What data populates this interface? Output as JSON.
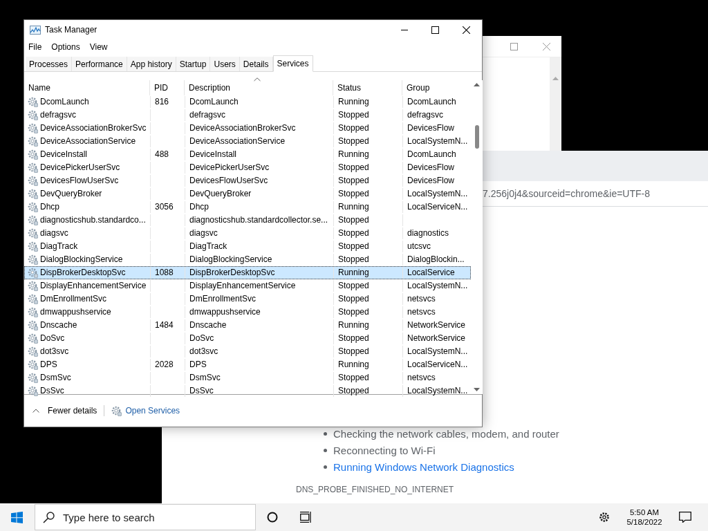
{
  "task_manager": {
    "title": "Task Manager",
    "menu": [
      "File",
      "Options",
      "View"
    ],
    "tabs": [
      {
        "label": "Processes",
        "selected": false
      },
      {
        "label": "Performance",
        "selected": false
      },
      {
        "label": "App history",
        "selected": false
      },
      {
        "label": "Startup",
        "selected": false
      },
      {
        "label": "Users",
        "selected": false
      },
      {
        "label": "Details",
        "selected": false
      },
      {
        "label": "Services",
        "selected": true
      }
    ],
    "columns": [
      "Name",
      "PID",
      "Description",
      "Status",
      "Group"
    ],
    "rows": [
      {
        "name": "DcomLaunch",
        "pid": "816",
        "description": "DcomLaunch",
        "status": "Running",
        "group": "DcomLaunch",
        "selected": false
      },
      {
        "name": "defragsvc",
        "description": "defragsvc",
        "status": "Stopped",
        "group": "defragsvc",
        "selected": false
      },
      {
        "name": "DeviceAssociationBrokerSvc",
        "description": "DeviceAssociationBrokerSvc",
        "status": "Stopped",
        "group": "DevicesFlow",
        "selected": false
      },
      {
        "name": "DeviceAssociationService",
        "description": "DeviceAssociationService",
        "status": "Stopped",
        "group": "LocalSystemN...",
        "selected": false
      },
      {
        "name": "DeviceInstall",
        "pid": "488",
        "description": "DeviceInstall",
        "status": "Running",
        "group": "DcomLaunch",
        "selected": false
      },
      {
        "name": "DevicePickerUserSvc",
        "description": "DevicePickerUserSvc",
        "status": "Stopped",
        "group": "DevicesFlow",
        "selected": false
      },
      {
        "name": "DevicesFlowUserSvc",
        "description": "DevicesFlowUserSvc",
        "status": "Stopped",
        "group": "DevicesFlow",
        "selected": false
      },
      {
        "name": "DevQueryBroker",
        "description": "DevQueryBroker",
        "status": "Stopped",
        "group": "LocalSystemN...",
        "selected": false
      },
      {
        "name": "Dhcp",
        "pid": "3056",
        "description": "Dhcp",
        "status": "Running",
        "group": "LocalServiceN...",
        "selected": false
      },
      {
        "name": "diagnosticshub.standardco...",
        "description": "diagnosticshub.standardcollector.se...",
        "status": "Stopped",
        "selected": false
      },
      {
        "name": "diagsvc",
        "description": "diagsvc",
        "status": "Stopped",
        "group": "diagnostics",
        "selected": false
      },
      {
        "name": "DiagTrack",
        "description": "DiagTrack",
        "status": "Stopped",
        "group": "utcsvc",
        "selected": false
      },
      {
        "name": "DialogBlockingService",
        "description": "DialogBlockingService",
        "status": "Stopped",
        "group": "DialogBlockin...",
        "selected": false
      },
      {
        "name": "DispBrokerDesktopSvc",
        "pid": "1088",
        "description": "DispBrokerDesktopSvc",
        "status": "Running",
        "group": "LocalService",
        "selected": true
      },
      {
        "name": "DisplayEnhancementService",
        "description": "DisplayEnhancementService",
        "status": "Stopped",
        "group": "LocalSystemN...",
        "selected": false
      },
      {
        "name": "DmEnrollmentSvc",
        "description": "DmEnrollmentSvc",
        "status": "Stopped",
        "group": "netsvcs",
        "selected": false
      },
      {
        "name": "dmwappushservice",
        "description": "dmwappushservice",
        "status": "Stopped",
        "group": "netsvcs",
        "selected": false
      },
      {
        "name": "Dnscache",
        "pid": "1484",
        "description": "Dnscache",
        "status": "Running",
        "group": "NetworkService",
        "selected": false
      },
      {
        "name": "DoSvc",
        "description": "DoSvc",
        "status": "Stopped",
        "group": "NetworkService",
        "selected": false
      },
      {
        "name": "dot3svc",
        "description": "dot3svc",
        "status": "Stopped",
        "group": "LocalSystemN...",
        "selected": false
      },
      {
        "name": "DPS",
        "pid": "2028",
        "description": "DPS",
        "status": "Running",
        "group": "LocalServiceN...",
        "selected": false
      },
      {
        "name": "DsmSvc",
        "description": "DsmSvc",
        "status": "Stopped",
        "group": "netsvcs",
        "selected": false
      },
      {
        "name": "DsSvc",
        "description": "DsSvc",
        "status": "Stopped",
        "group": "LocalSystemN...",
        "selected": false
      }
    ],
    "fewer_details": "Fewer details",
    "open_services": "Open Services"
  },
  "browser": {
    "address": "7.256j0j4&sourceid=chrome&ie=UTF-8",
    "suggestions": [
      {
        "kind": "text",
        "text": "Checking the network cables, modem, and router"
      },
      {
        "kind": "text",
        "text": "Reconnecting to Wi-Fi"
      },
      {
        "kind": "link",
        "text": "Running Windows Network Diagnostics"
      }
    ],
    "error_code": "DNS_PROBE_FINISHED_NO_INTERNET"
  },
  "taskbar": {
    "search_placeholder": "Type here to search",
    "time": "5:50 AM",
    "date": "5/18/2022"
  }
}
